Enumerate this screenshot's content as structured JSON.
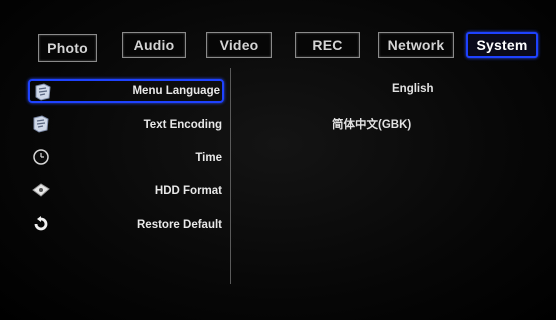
{
  "tabs": [
    {
      "label": "Photo",
      "active": false
    },
    {
      "label": "Audio",
      "active": false
    },
    {
      "label": "Video",
      "active": false
    },
    {
      "label": "REC",
      "active": false
    },
    {
      "label": "Network",
      "active": false
    },
    {
      "label": "System",
      "active": true
    }
  ],
  "menu": [
    {
      "label": "Menu Language",
      "icon": "language-icon",
      "selected": true
    },
    {
      "label": "Text Encoding",
      "icon": "text-encoding-icon",
      "selected": false
    },
    {
      "label": "Time",
      "icon": "clock-icon",
      "selected": false
    },
    {
      "label": "HDD Format",
      "icon": "hdd-icon",
      "selected": false
    },
    {
      "label": "Restore Default",
      "icon": "restore-icon",
      "selected": false
    }
  ],
  "values": {
    "menu_language": "English",
    "text_encoding": "简体中文(GBK)"
  },
  "colors": {
    "accent": "#1e42ff",
    "text": "#e8e8e8",
    "background": "#000000"
  }
}
